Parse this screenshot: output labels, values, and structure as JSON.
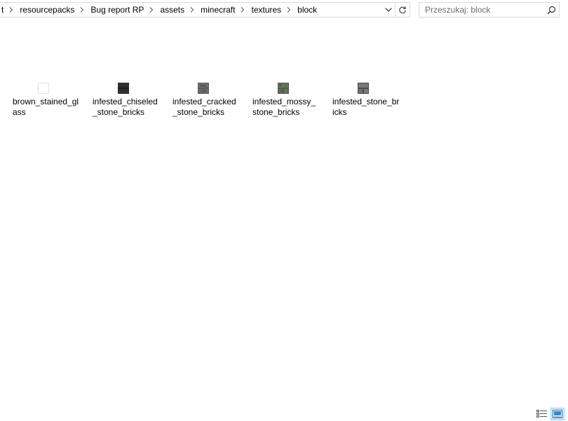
{
  "breadcrumb": [
    "t",
    "resourcepacks",
    "Bug report RP",
    "assets",
    "minecraft",
    "textures",
    "block"
  ],
  "search": {
    "placeholder": "Przeszukaj: block"
  },
  "files": [
    {
      "name": "brown_stained_glass",
      "icon": "white-texture-icon"
    },
    {
      "name": "infested_chiseled_stone_bricks",
      "icon": "dark-stone-texture-icon"
    },
    {
      "name": "infested_cracked_stone_bricks",
      "icon": "cracked-stone-texture-icon"
    },
    {
      "name": "infested_mossy_stone_bricks",
      "icon": "mossy-stone-texture-icon"
    },
    {
      "name": "infested_stone_bricks",
      "icon": "stone-bricks-texture-icon"
    }
  ],
  "view_mode": "large-icons",
  "colors": {
    "accent": "#cce8ff",
    "border": "#d9d9d9"
  }
}
